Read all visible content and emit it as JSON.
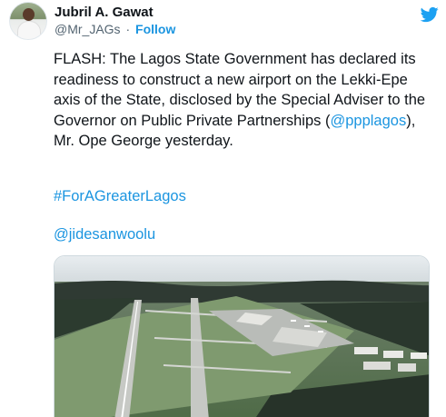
{
  "author": {
    "name": "Jubril A. Gawat",
    "handle": "@Mr_JAGs",
    "separator": "·",
    "follow_label": "Follow"
  },
  "tweet": {
    "text_before_link": "FLASH: The Lagos State Government has declared its readiness to construct a new airport on the Lekki-Epe axis of the State, disclosed by the Special Adviser to the Governor on Public Private Partnerships (",
    "link_text": "@ppplagos",
    "text_after_link": "), Mr. Ope George yesterday.",
    "hashtag": "#ForAGreaterLagos",
    "mention": "@jidesanwoolu"
  },
  "colors": {
    "link": "#1b95e0",
    "text": "#0f1419",
    "secondary": "#536471"
  },
  "icons": {
    "logo": "twitter-bird-icon"
  }
}
